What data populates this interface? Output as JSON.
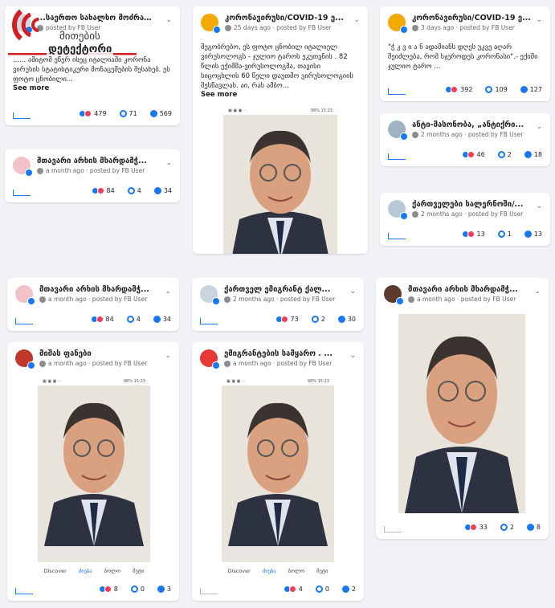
{
  "logo": {
    "line1": "მითების",
    "line2": "დეტექტორი"
  },
  "cards": [
    {
      "title": "...საერთო სახალხო მოძრაო...",
      "meta": "posted by FB User",
      "text": "...... ამიტომ ეწერ ისეც იტალიაში კორონა ვირუსის სტატისტიკური მონაცემების შესახებ. ეს ფოტო ცნობილი...",
      "see_more": "See more",
      "reactions": "479",
      "comments": "71",
      "shares": "569"
    },
    {
      "title": "კორონავირუსი/COVID-19 ე...",
      "meta": "25 days ago · posted by FB User",
      "text": "მეგობრებო, ეს ფოტო ცნობილ იტალიელ ვირუსოლოგს - ჯულიო ტაროს ეკუთვნის . 82 წლის ექიმმა-ვირუსოლოგმა, თავისი სიცოცხლის 60 წელი დაუთმო ვირუსოლოგიის შესწავლას. აი, რას ამბო...",
      "see_more": "See more"
    },
    {
      "title": "კორონავირუსი/COVID-19 ე...",
      "meta": "3 days ago · posted by FB User",
      "text": "\"ჭ კ ვ ი ა ნ ადამიანს დღეს უკვე აღარ შეიძლება, რომ სჯეროდეს კორონასი\".- ექიმი ჯულიო ტარო ...",
      "reactions": "392",
      "comments": "109",
      "shares": "127"
    },
    {
      "title": "მთავარი არხის მხარდამჭ...",
      "meta": "a month ago · posted by FB User",
      "reactions": "84",
      "comments": "4",
      "shares": "34"
    },
    {
      "title": "ანტი-მასონობა, „ანტიქრი...",
      "meta": "2 months ago · posted by FB User",
      "reactions": "46",
      "comments": "2",
      "shares": "18"
    },
    {
      "title": "ქართველები სალერნოში/...",
      "meta": "2 months ago · posted by FB User",
      "reactions": "13",
      "comments": "1",
      "shares": "13"
    },
    {
      "title": "მთავარი არხის მხარდამჭ...",
      "meta": "a month ago · posted by FB User",
      "reactions": "84",
      "comments": "4",
      "shares": "34"
    },
    {
      "title": "ქართველ ემიგრანტ ქალ...",
      "meta": "2 months ago · posted by FB User",
      "reactions": "73",
      "comments": "2",
      "shares": "30"
    },
    {
      "title": "მთავარი არხის მხარდამჭ...",
      "meta": "a month ago · posted by FB User",
      "reactions": "33",
      "comments": "2",
      "shares": "8"
    },
    {
      "title": "მიშას ფანები",
      "meta": "a month ago · posted by FB User",
      "reactions": "8",
      "comments": "0",
      "shares": "3"
    },
    {
      "title": "ემიგრანტების სამყარო . ...",
      "meta": "a month ago · posted by FB User",
      "reactions": "4",
      "comments": "0",
      "shares": "2"
    }
  ],
  "phone_nav": [
    "Discover",
    "ძიება",
    "ბოლო",
    "მეტი"
  ],
  "phone_status": "98% 15:23",
  "colors": {
    "fb_blue": "#1877f2",
    "background": "#f0f2f5",
    "logo_red": "#d21f26"
  }
}
